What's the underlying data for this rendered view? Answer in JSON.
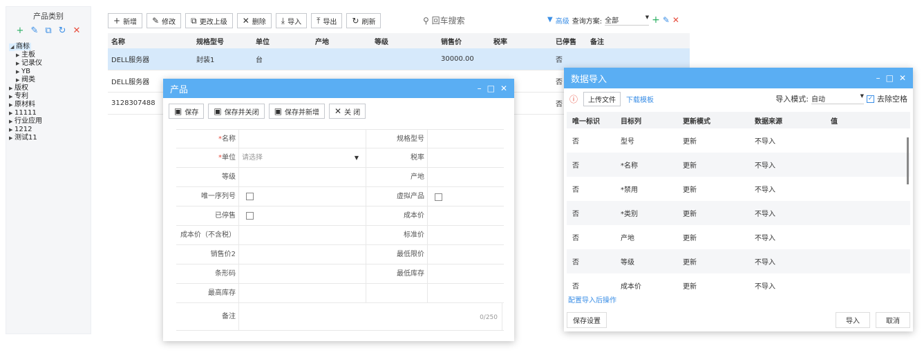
{
  "left_panel": {
    "title": "产品类别",
    "tools": [
      "+",
      "✎",
      "⧉",
      "↻",
      "✕"
    ],
    "tree": [
      {
        "label": "商标",
        "expanded": true,
        "selected": true,
        "level": 0
      },
      {
        "label": "主板",
        "level": 1
      },
      {
        "label": "记录仪",
        "level": 1
      },
      {
        "label": "YB",
        "level": 1
      },
      {
        "label": "阀类",
        "level": 1
      },
      {
        "label": "版权",
        "level": 0
      },
      {
        "label": "专利",
        "level": 0
      },
      {
        "label": "原材料",
        "level": 0
      },
      {
        "label": "11111",
        "level": 0
      },
      {
        "label": "行业应用",
        "level": 0
      },
      {
        "label": "1212",
        "level": 0
      },
      {
        "label": "测试11",
        "level": 0
      }
    ]
  },
  "toolbar": {
    "add": "新增",
    "edit": "修改",
    "change_parent": "更改上级",
    "delete": "删除",
    "import": "导入",
    "export": "导出",
    "refresh": "刷新"
  },
  "search": {
    "placeholder": "回车搜索"
  },
  "advanced": {
    "label": "高级",
    "scheme_label": "查询方案:",
    "scheme_value": "全部"
  },
  "grid": {
    "headers": [
      "名称",
      "规格型号",
      "单位",
      "产地",
      "等级",
      "销售价",
      "税率",
      "已停售",
      "备注"
    ],
    "rows": [
      [
        "DELL服务器",
        "封装1",
        "台",
        "",
        "",
        "30000.00",
        "",
        "否",
        ""
      ],
      [
        "DELL服务器",
        "",
        "",
        "",
        "",
        "",
        "",
        "否",
        ""
      ],
      [
        "3128307488",
        "",
        "",
        "",
        "",
        "",
        "",
        "否",
        ""
      ]
    ]
  },
  "product_modal": {
    "title": "产品",
    "buttons": {
      "save": "保存",
      "save_close": "保存并关闭",
      "save_new": "保存并新增",
      "close": "关 闭"
    },
    "fields": {
      "name": "名称",
      "spec": "规格型号",
      "unit": "单位",
      "unit_placeholder": "请选择",
      "tax": "税率",
      "grade": "等级",
      "origin": "产地",
      "serial": "唯一序列号",
      "virtual": "虚拟产品",
      "stopped": "已停售",
      "cost": "成本价",
      "cost_notax": "成本价（不含税）",
      "std_price": "标准价",
      "sale_price2": "销售价2",
      "min_price": "最低限价",
      "barcode": "条形码",
      "min_stock": "最低库存",
      "max_stock": "最高库存",
      "remark": "备注",
      "remark_count": "0/250"
    }
  },
  "import_modal": {
    "title": "数据导入",
    "upload": "上传文件",
    "download_template": "下载模板",
    "mode_label": "导入模式:",
    "mode_value": "自动",
    "trim_label": "去除空格",
    "headers": [
      "唯一标识",
      "目标列",
      "更新模式",
      "数据来源",
      "值"
    ],
    "rows": [
      [
        "否",
        "型号",
        "更新",
        "不导入",
        ""
      ],
      [
        "否",
        "*名称",
        "更新",
        "不导入",
        ""
      ],
      [
        "否",
        "*禁用",
        "更新",
        "不导入",
        ""
      ],
      [
        "否",
        "*类别",
        "更新",
        "不导入",
        ""
      ],
      [
        "否",
        "产地",
        "更新",
        "不导入",
        ""
      ],
      [
        "否",
        "等级",
        "更新",
        "不导入",
        ""
      ],
      [
        "否",
        "成本价",
        "更新",
        "不导入",
        ""
      ]
    ],
    "after_config": "配置导入后操作",
    "save_settings": "保存设置",
    "import_btn": "导入",
    "cancel_btn": "取消"
  },
  "colors": {
    "accent": "#5aaef3",
    "link": "#3a8ee6",
    "danger": "#e74c3c",
    "green": "#27ae60"
  }
}
